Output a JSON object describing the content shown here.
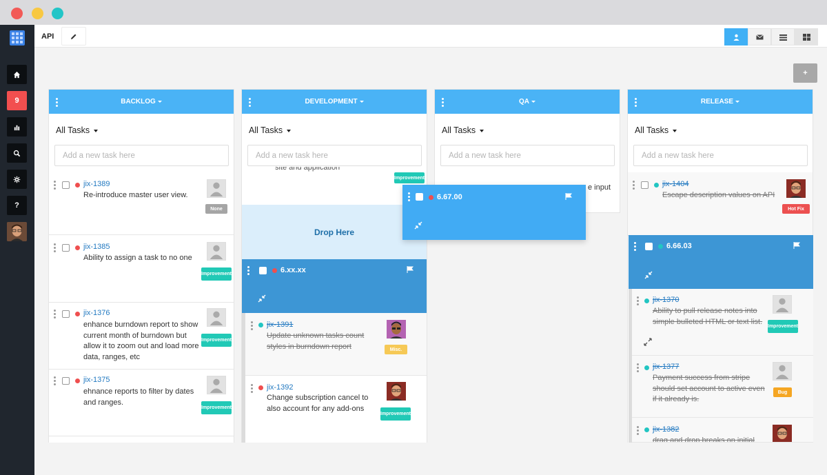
{
  "window": {
    "colors": {
      "close": "#f25a57",
      "minimize": "#f8c842",
      "zoom": "#22c5c7"
    }
  },
  "sidebar": {
    "logo_icon": "grid-logo-icon",
    "items": [
      {
        "name": "home",
        "icon": "home-icon"
      },
      {
        "name": "notifications",
        "badge": "9"
      },
      {
        "name": "reports",
        "icon": "bar-chart-icon"
      },
      {
        "name": "search",
        "icon": "search-icon"
      },
      {
        "name": "settings",
        "icon": "gear-icon"
      },
      {
        "name": "help",
        "label": "?"
      },
      {
        "name": "profile",
        "icon": "avatar"
      }
    ]
  },
  "topbar": {
    "project": "API",
    "edit_icon": "pencil-icon",
    "views": [
      {
        "icon": "user-icon",
        "active": true
      },
      {
        "icon": "mail-icon",
        "active": false
      },
      {
        "icon": "list-icon",
        "active": false
      },
      {
        "icon": "board-icon",
        "active": false,
        "selected": true
      }
    ],
    "add_column_label": "+"
  },
  "columns": [
    {
      "title": "BACKLOG",
      "filter": "All Tasks",
      "add_placeholder": "Add a new task here",
      "cards": [
        {
          "id": "jix-1389",
          "title": "Re-introduce master user view.",
          "priority": "red",
          "tag": "None",
          "avatar": "placeholder"
        },
        {
          "id": "jix-1385",
          "title": "Ability to assign a task to no one",
          "priority": "red",
          "tag": "Improvement",
          "avatar": "placeholder"
        },
        {
          "id": "jix-1376",
          "title": "enhance burndown report to show current month of burndown but allow it to zoom out and load more data, ranges, etc",
          "priority": "red",
          "tag": "Improvement",
          "avatar": "placeholder"
        },
        {
          "id": "jix-1375",
          "title": "ehnance reports to filter by dates and ranges.",
          "priority": "red",
          "tag": "Improvement",
          "avatar": "placeholder"
        }
      ]
    },
    {
      "title": "DEVELOPMENT",
      "filter": "All Tasks",
      "add_placeholder": "Add a new task here",
      "partial_card_text": "site and application",
      "partial_tag": "Improvement",
      "drop_label": "Drop Here",
      "group": {
        "version": "6.xx.xx",
        "priority": "red"
      },
      "cards": [
        {
          "id": "jix-1391",
          "title": "Update unknown tasks count styles in burndown report",
          "priority": "teal",
          "tag": "Misc.",
          "done": true,
          "avatar": "photo-purple"
        },
        {
          "id": "jix-1392",
          "title": "Change subscription cancel to also account for any add-ons",
          "priority": "red",
          "tag": "Improvement",
          "done": false,
          "avatar": "photo-red"
        }
      ]
    },
    {
      "title": "QA",
      "filter": "All Tasks",
      "add_placeholder": "Add a new task here",
      "partial_card_text": "e input"
    },
    {
      "title": "RELEASE",
      "filter": "All Tasks",
      "add_placeholder": "Add a new task here",
      "cards_top": [
        {
          "id": "jix-1404",
          "title": "Escape description values on API",
          "priority": "teal",
          "tag": "Hot Fix",
          "done": true,
          "avatar": "photo-red"
        }
      ],
      "group": {
        "version": "6.66.03",
        "priority": "teal"
      },
      "cards": [
        {
          "id": "jix-1370",
          "title": "Ability to pull release notes into simple bulleted HTML or text list.",
          "priority": "teal",
          "tag": "Improvement",
          "done": true,
          "avatar": "placeholder"
        },
        {
          "id": "jix-1377",
          "title": "Payment success from stripe should set account to active even if it already is.",
          "priority": "teal",
          "tag": "Bug",
          "done": true,
          "avatar": "placeholder"
        },
        {
          "id": "jix-1382",
          "title": "drag and drop breaks on initial",
          "priority": "teal",
          "done": true,
          "avatar": "photo-red"
        }
      ]
    }
  ],
  "dragging": {
    "version": "6.67.00",
    "priority": "red"
  },
  "tag_labels": {
    "improvement_line1": "Improve",
    "improvement_line2": "ment"
  }
}
